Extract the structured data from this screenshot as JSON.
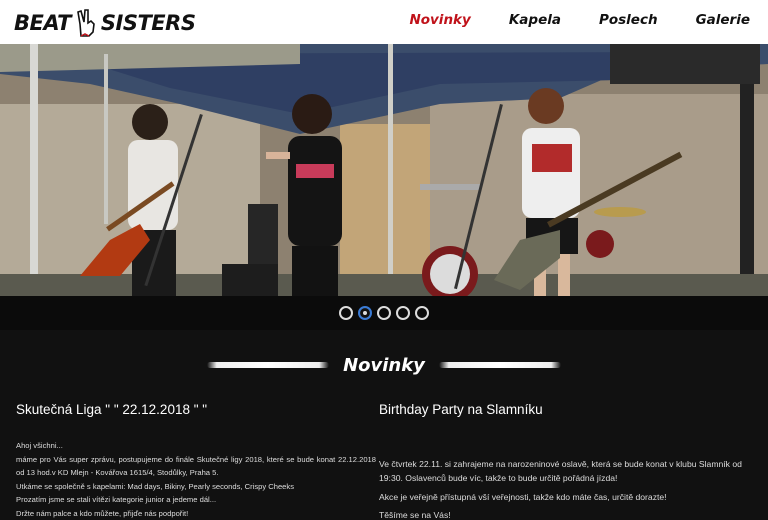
{
  "header": {
    "logo_left": "BEAT",
    "logo_right": "SISTERS",
    "nav": [
      {
        "label": "Novinky",
        "active": true
      },
      {
        "label": "Kapela",
        "active": false
      },
      {
        "label": "Poslech",
        "active": false
      },
      {
        "label": "Galerie",
        "active": false
      }
    ]
  },
  "slider": {
    "dot_count": 5,
    "active_index": 1
  },
  "section": {
    "title": "Novinky"
  },
  "articles": [
    {
      "title": "Skutečná Liga \" \" 22.12.2018 \" \"",
      "lines": [
        "Ahoj všichni...",
        "máme pro Vás super zprávu, postupujeme do finále Skutečné ligy 2018, které se bude konat 22.12.2018 od 13 hod.v KD Mlejn - Kovářova 1615/4, Stodůlky, Praha 5.",
        "Utkáme se společně s kapelami: Mad days, Bikiny, Pearly seconds, Crispy Cheeks",
        "Prozatím jsme se stali vítězi kategorie junior a jedeme dál...",
        "Držte nám palce a kdo můžete, přijďe nás podpořit!"
      ]
    },
    {
      "title": "Birthday Party na Slamníku",
      "lines": [
        "Ve čtvrtek 22.11. si zahrajeme na narozeninové oslavě, která se bude konat v klubu Slamník od 19:30. Oslavenců bude víc, takže to bude určitě pořádná jízda!",
        "Akce je veřejně přístupná vší veřejnosti, takže kdo máte čas, určitě dorazte!",
        "Těšíme se na Vás!"
      ]
    }
  ],
  "colors": {
    "accent": "#c0121a",
    "background": "#111111",
    "header_bg": "#ffffff"
  }
}
